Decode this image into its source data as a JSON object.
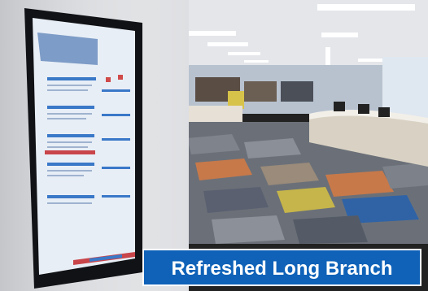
{
  "caption": {
    "text": "Refreshed Long Branch"
  },
  "colors": {
    "caption_bg": "#0f62b8",
    "caption_text": "#ffffff",
    "screen_bg": "#e8eef6",
    "screen_accent": "#3a78c8",
    "carpet_blue": "#2f63a6",
    "carpet_orange": "#c7794a",
    "carpet_yellow": "#c6b54a"
  }
}
